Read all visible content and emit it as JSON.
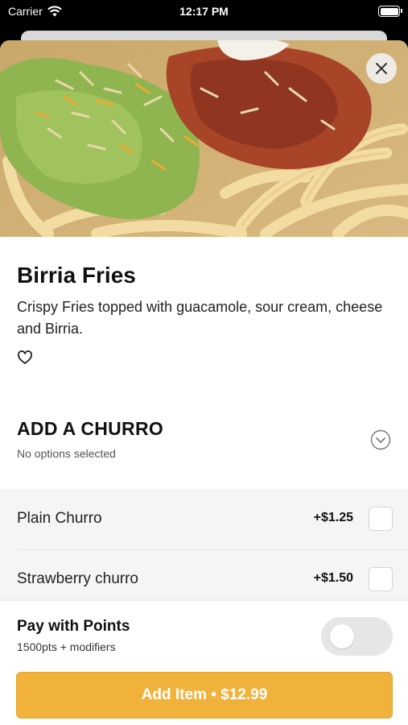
{
  "status_bar": {
    "carrier": "Carrier",
    "time": "12:17 PM",
    "wifi_icon": "wifi-icon",
    "battery_icon": "battery-icon"
  },
  "hero": {
    "image_alt": "Birria Fries photo",
    "close_icon": "close-icon"
  },
  "item": {
    "title": "Birria Fries",
    "description": "Crispy Fries topped with guacamole, sour cream, cheese and Birria.",
    "favorite_icon": "heart-outline-icon"
  },
  "modifier_group": {
    "title": "ADD A CHURRO",
    "subtitle": "No options selected",
    "expand_icon": "chevron-down-circle-icon",
    "options": [
      {
        "label": "Plain Churro",
        "price": "+$1.25",
        "checked": false
      },
      {
        "label": "Strawberry churro",
        "price": "+$1.50",
        "checked": false
      }
    ]
  },
  "footer": {
    "points_title": "Pay with Points",
    "points_subtitle": "1500pts + modifiers",
    "points_toggle_on": false,
    "add_button_label": "Add Item • $12.99"
  },
  "colors": {
    "accent": "#f1b23c",
    "toggle_off": "#e6e6e6",
    "options_background": "#f5f5f5"
  }
}
